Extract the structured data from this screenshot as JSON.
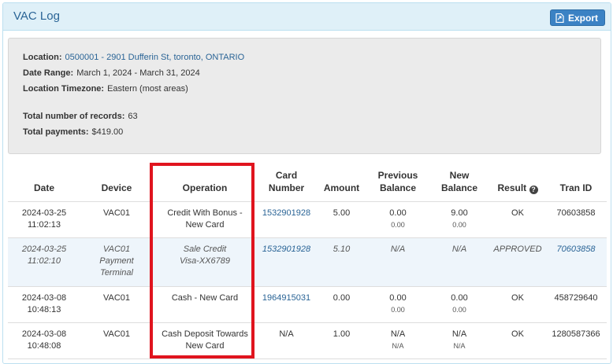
{
  "panel": {
    "title": "VAC Log",
    "export_label": "Export"
  },
  "info": {
    "location_label": "Location:",
    "location_value": "0500001 - 2901 Dufferin St, toronto, ONTARIO",
    "date_range_label": "Date Range:",
    "date_range_value": "March 1, 2024 - March 31, 2024",
    "timezone_label": "Location Timezone:",
    "timezone_value": "Eastern (most areas)",
    "total_records_label": "Total number of records:",
    "total_records_value": "63",
    "total_payments_label": "Total payments:",
    "total_payments_value": "$419.00"
  },
  "table": {
    "headers": {
      "date": "Date",
      "device": "Device",
      "operation": "Operation",
      "card_number_1": "Card",
      "card_number_2": "Number",
      "amount": "Amount",
      "prev_1": "Previous",
      "prev_2": "Balance",
      "new_1": "New",
      "new_2": "Balance",
      "result": "Result",
      "tran_id": "Tran ID"
    },
    "rows": [
      {
        "date_1": "2024-03-25",
        "date_2": "11:02:13",
        "device_1": "VAC01",
        "device_2": "",
        "device_3": "",
        "op_1": "Credit With Bonus -",
        "op_2": "New Card",
        "card": "1532901928",
        "amount": "5.00",
        "prev": "0.00",
        "prev_sub": "0.00",
        "new": "9.00",
        "new_sub": "0.00",
        "result": "OK",
        "tran": "70603858"
      },
      {
        "date_1": "2024-03-25",
        "date_2": "11:02:10",
        "device_1": "VAC01",
        "device_2": "Payment",
        "device_3": "Terminal",
        "op_1": "Sale Credit",
        "op_2": "Visa-XX6789",
        "card": "1532901928",
        "amount": "5.10",
        "prev": "N/A",
        "prev_sub": "",
        "new": "N/A",
        "new_sub": "",
        "result": "APPROVED",
        "tran": "70603858"
      },
      {
        "date_1": "2024-03-08",
        "date_2": "10:48:13",
        "device_1": "VAC01",
        "device_2": "",
        "device_3": "",
        "op_1": "Cash - New Card",
        "op_2": "",
        "card": "1964915031",
        "amount": "0.00",
        "prev": "0.00",
        "prev_sub": "0.00",
        "new": "0.00",
        "new_sub": "0.00",
        "result": "OK",
        "tran": "458729640"
      },
      {
        "date_1": "2024-03-08",
        "date_2": "10:48:08",
        "device_1": "VAC01",
        "device_2": "",
        "device_3": "",
        "op_1": "Cash Deposit Towards",
        "op_2": "New Card",
        "card": "N/A",
        "amount": "1.00",
        "prev": "N/A",
        "prev_sub": "N/A",
        "new": "N/A",
        "new_sub": "N/A",
        "result": "OK",
        "tran": "1280587366"
      }
    ]
  },
  "colors": {
    "header_bg": "#dff0f8",
    "link": "#2a6496",
    "export_button": "#3b82c4",
    "highlight": "#e0141e"
  }
}
